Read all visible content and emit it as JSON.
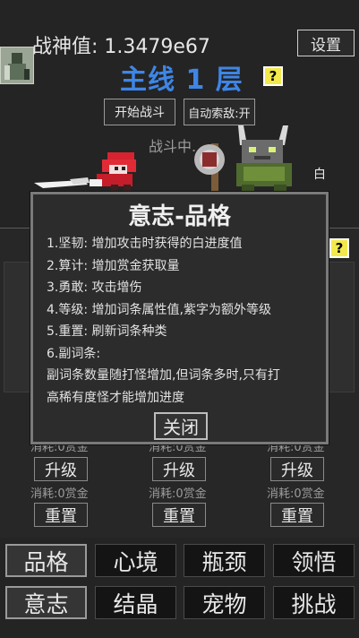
{
  "header": {
    "power_label": "战神值:",
    "power_value": "1.3479e67",
    "settings_label": "设置",
    "stage_title": "主线 1 层",
    "help_label": "?"
  },
  "battle": {
    "start_label": "开始战斗",
    "auto_label": "自动索敌:开",
    "status_text": "战斗中...",
    "side_char": "白"
  },
  "modal": {
    "title": "意志-品格",
    "lines": [
      "1.坚韧: 增加攻击时获得的白进度值",
      "2.算计: 增加赏金获取量",
      "3.勇敢: 攻击增伤",
      "4.等级: 增加词条属性值,紫字为额外等级",
      "5.重置: 刷新词条种类",
      "6.副词条:",
      "副词条数量随打怪增加,但词条多时,只有打",
      "高稀有度怪才能增加进度"
    ],
    "close_label": "关闭"
  },
  "upgrade_columns": [
    {
      "cost_top": "消耗:0赏金",
      "upgrade_label": "升级",
      "cost_bottom": "消耗:0赏金",
      "reset_label": "重置"
    },
    {
      "cost_top": "消耗:0赏金",
      "upgrade_label": "升级",
      "cost_bottom": "消耗:0赏金",
      "reset_label": "重置"
    },
    {
      "cost_top": "消耗:0赏金",
      "upgrade_label": "升级",
      "cost_bottom": "消耗:0赏金",
      "reset_label": "重置"
    }
  ],
  "tabs_row1": [
    "品格",
    "心境",
    "瓶颈",
    "领悟"
  ],
  "tabs_row2": [
    "意志",
    "结晶",
    "宠物",
    "挑战"
  ],
  "second_help_label": "?"
}
